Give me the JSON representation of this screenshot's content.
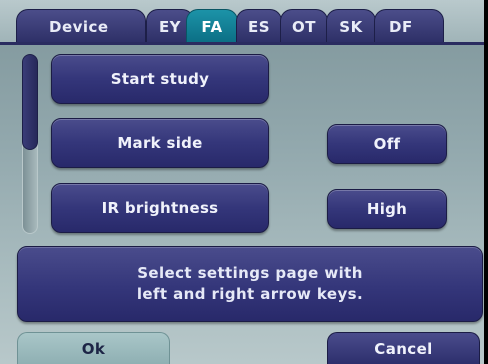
{
  "tabs": [
    {
      "label": "Device",
      "active": false
    },
    {
      "label": "EY",
      "active": false
    },
    {
      "label": "FA",
      "active": true
    },
    {
      "label": "ES",
      "active": false
    },
    {
      "label": "OT",
      "active": false
    },
    {
      "label": "SK",
      "active": false
    },
    {
      "label": "DF",
      "active": false
    }
  ],
  "settings": {
    "start_study": {
      "label": "Start study"
    },
    "mark_side": {
      "label": "Mark side",
      "value": "Off"
    },
    "ir_brightness": {
      "label": "IR brightness",
      "value": "High"
    }
  },
  "message": {
    "line1": "Select settings page with",
    "line2": "left and right arrow keys."
  },
  "softkeys": {
    "ok": "Ok",
    "cancel": "Cancel"
  },
  "colors": {
    "button": "#34367a",
    "active_tab": "#1187a0",
    "background": "#9fb3b7"
  }
}
